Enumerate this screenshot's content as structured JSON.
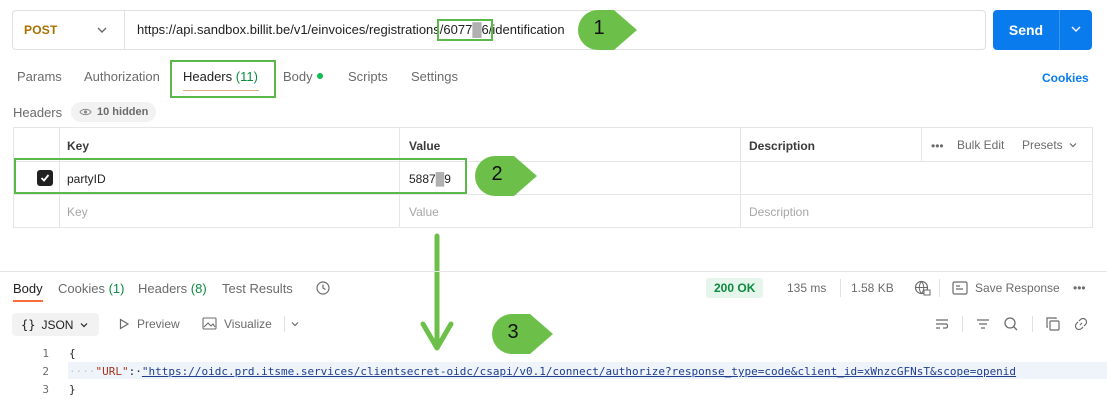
{
  "request": {
    "method": "POST",
    "url_prefix": "https://api.sandbox.billit.be/v1/einvoices/registrations/6077",
    "url_blur": "█",
    "url_mid": "6",
    "url_suffix": "/identification",
    "send_label": "Send"
  },
  "request_tabs": {
    "params": "Params",
    "authorization": "Authorization",
    "headers": "Headers",
    "headers_count": "(11)",
    "body": "Body",
    "scripts": "Scripts",
    "settings": "Settings",
    "cookies": "Cookies"
  },
  "headers_section": {
    "title": "Headers",
    "hidden_label": "10 hidden",
    "columns": {
      "key": "Key",
      "value": "Value",
      "description": "Description"
    },
    "bulk_edit": "Bulk Edit",
    "presets": "Presets",
    "row": {
      "key": "partyID",
      "value_prefix": "5887",
      "value_blur": "█",
      "value_suffix": "9",
      "checked": true
    },
    "placeholders": {
      "key": "Key",
      "value": "Value",
      "description": "Description"
    }
  },
  "response": {
    "tabs": {
      "body": "Body",
      "cookies": "Cookies",
      "cookies_count": "(1)",
      "headers": "Headers",
      "headers_count": "(8)",
      "test_results": "Test Results"
    },
    "status": "200 OK",
    "time": "135 ms",
    "size": "1.58 KB",
    "save_response": "Save Response",
    "format": "JSON",
    "preview": "Preview",
    "visualize": "Visualize",
    "lines": [
      "1",
      "2",
      "3"
    ],
    "code": {
      "open": "{",
      "indent": "····",
      "key": "\"URL\"",
      "colon": ":·",
      "value": "\"https://oidc.prd.itsme.services/clientsecret-oidc/csapi/v0.1/connect/authorize?response_type=code&client_id=xWnzcGFNsT&scope=openid",
      "close": "}"
    }
  },
  "annotations": {
    "one": "1",
    "two": "2",
    "three": "3"
  },
  "colors": {
    "send": "#097bed",
    "annotation_green": "#6cc04a",
    "post_method": "#a86f00",
    "status_ok": "#0c8a3e"
  }
}
